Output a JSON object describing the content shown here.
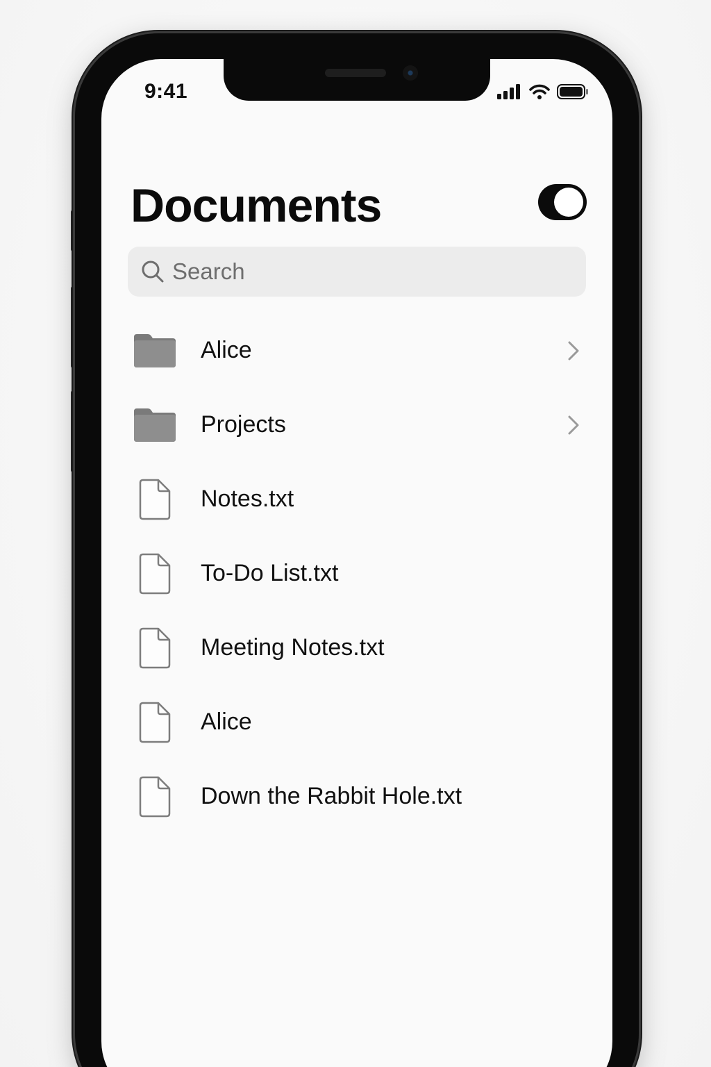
{
  "status_bar": {
    "time": "9:41"
  },
  "header": {
    "title": "Documents",
    "toggle_on": true
  },
  "search": {
    "placeholder": "Search",
    "value": ""
  },
  "items": [
    {
      "label": "Alice",
      "kind": "folder",
      "icon": "folder-icon",
      "has_chevron": true
    },
    {
      "label": "Projects",
      "kind": "folder",
      "icon": "folder-icon",
      "has_chevron": true
    },
    {
      "label": "Notes.txt",
      "kind": "file",
      "icon": "document-icon",
      "has_chevron": false
    },
    {
      "label": "To-Do List.txt",
      "kind": "file",
      "icon": "document-icon",
      "has_chevron": false
    },
    {
      "label": "Meeting Notes.txt",
      "kind": "file",
      "icon": "document-icon",
      "has_chevron": false
    },
    {
      "label": "Alice",
      "kind": "file",
      "icon": "document-icon",
      "has_chevron": false
    },
    {
      "label": "Down the Rabbit Hole.txt",
      "kind": "file",
      "icon": "document-icon",
      "has_chevron": false
    }
  ],
  "colors": {
    "folder": "#8e8e8e",
    "folder_tab": "#7a7a7a",
    "file_stroke": "#7d7d7d",
    "chevron": "#9a9a9a",
    "text": "#111111",
    "search_bg": "#ececec"
  }
}
